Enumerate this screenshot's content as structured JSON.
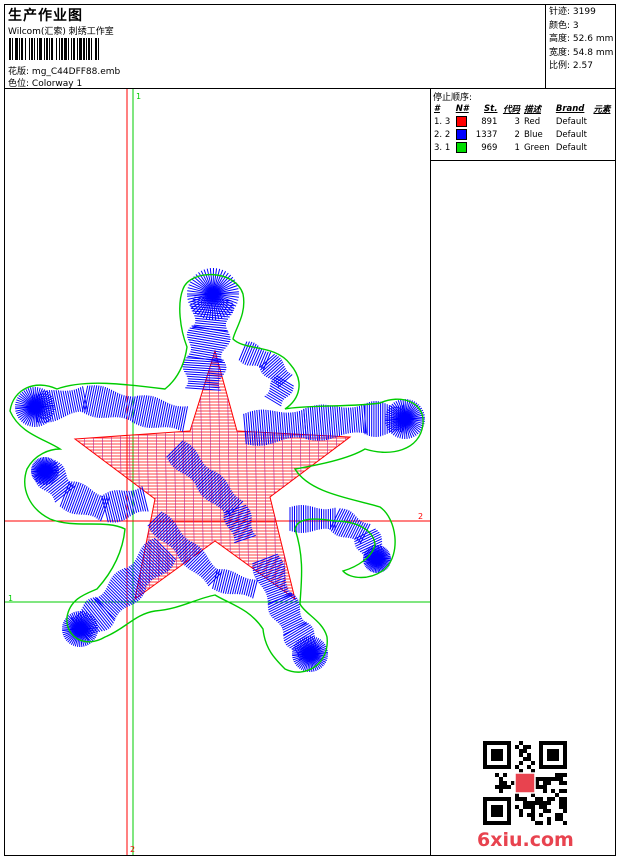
{
  "header": {
    "title": "生产作业图",
    "studio": "Wilcom(汇索) 刺绣工作室",
    "design_label": "花版:",
    "design_file": "mg_C44DFF88.emb",
    "colorway_label": "色位:",
    "colorway": "Colorway 1"
  },
  "stats": [
    {
      "label": "针迹:",
      "value": "3199"
    },
    {
      "label": "颜色:",
      "value": "3"
    },
    {
      "label": "高度:",
      "value": "52.6 mm"
    },
    {
      "label": "宽度:",
      "value": "54.8 mm"
    },
    {
      "label": "比例:",
      "value": "2.57"
    }
  ],
  "stop_sequence": {
    "title": "停止顺序:",
    "columns": [
      "#",
      "N#",
      "St.",
      "代码",
      "描述",
      "Brand",
      "元素"
    ],
    "rows": [
      {
        "index": "1.",
        "needle": "3",
        "color": "#ff0000",
        "stitches": "891",
        "code": "3",
        "desc": "Red",
        "brand": "Default"
      },
      {
        "index": "2.",
        "needle": "2",
        "color": "#0000ff",
        "stitches": "1337",
        "code": "2",
        "desc": "Blue",
        "brand": "Default"
      },
      {
        "index": "3.",
        "needle": "1",
        "color": "#00cc00",
        "stitches": "969",
        "code": "1",
        "desc": "Green",
        "brand": "Default"
      }
    ]
  },
  "axes": {
    "red_v_label": "1",
    "red_h_label": "2",
    "green_v_label": "2",
    "green_h_label": "1"
  },
  "colors": {
    "red": "#ff0000",
    "blue": "#0000ff",
    "green": "#00cc00",
    "magenta": "#b0208a",
    "brand_red": "#e8434f"
  },
  "watermark": {
    "site": "6xiu.com"
  }
}
